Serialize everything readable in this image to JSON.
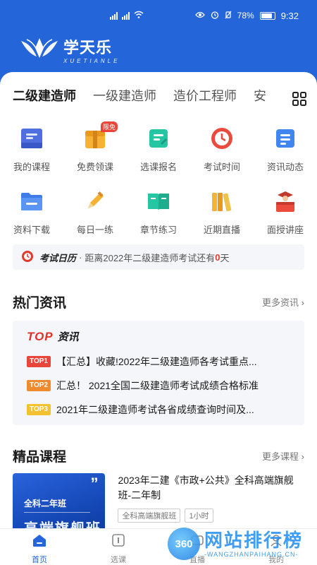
{
  "status_bar": {
    "battery": "78%",
    "time": "9:32"
  },
  "logo": {
    "name": "学天乐",
    "sub": "XUETIANLE"
  },
  "tabs": [
    "二级建造师",
    "一级建造师",
    "造价工程师",
    "安"
  ],
  "shortcuts": [
    {
      "label": "我的课程",
      "icon": "course-book-icon"
    },
    {
      "label": "免费领课",
      "icon": "gift-box-icon",
      "badge": "限免"
    },
    {
      "label": "选课报名",
      "icon": "signup-form-icon"
    },
    {
      "label": "考试时间",
      "icon": "clock-icon"
    },
    {
      "label": "资讯动态",
      "icon": "news-list-icon"
    },
    {
      "label": "资料下载",
      "icon": "folder-icon"
    },
    {
      "label": "每日一练",
      "icon": "pencil-icon"
    },
    {
      "label": "章节练习",
      "icon": "open-book-icon"
    },
    {
      "label": "近期直播",
      "icon": "books-icon"
    },
    {
      "label": "面授讲座",
      "icon": "lecture-podium-icon"
    }
  ],
  "calendar": {
    "title": "考试日历",
    "prefix": "距离2022年二级建造师考试还有",
    "days": "0",
    "suffix": "天"
  },
  "hot_news": {
    "title": "热门资讯",
    "more": "更多资讯",
    "brand_top": "TOP",
    "brand_zx": "资讯",
    "items": [
      {
        "rank": "TOP1",
        "color": "#e8463a",
        "text": "【汇总】收藏!2022年二级建造师各考试重点..."
      },
      {
        "rank": "TOP2",
        "color": "#f08a2e",
        "text": "汇总！ 2021全国二级建造师考试成绩合格标准"
      },
      {
        "rank": "TOP3",
        "color": "#f2c230",
        "text": "2021年二级建造师考试各省成绩查询时间及..."
      }
    ]
  },
  "courses": {
    "title": "精品课程",
    "more": "更多课程",
    "item": {
      "title": "2023年二建《市政+公共》全科高端旗舰班-二年制",
      "thumb_tag": "全科二年班",
      "thumb_big": "高端旗舰班",
      "tags": [
        "全科高端旗舰班",
        "1小时"
      ]
    }
  },
  "tabbar": [
    {
      "label": "首页",
      "active": true
    },
    {
      "label": "选课",
      "active": false
    },
    {
      "label": "直播",
      "active": false
    },
    {
      "label": "我的",
      "active": false
    }
  ],
  "watermark": {
    "circle": "360",
    "big": "网站排行榜",
    "small": "-WANGZHANPAIHANG.CN-"
  },
  "colors": {
    "brand_blue": "#2466d9",
    "accent_red": "#e23b2e"
  }
}
